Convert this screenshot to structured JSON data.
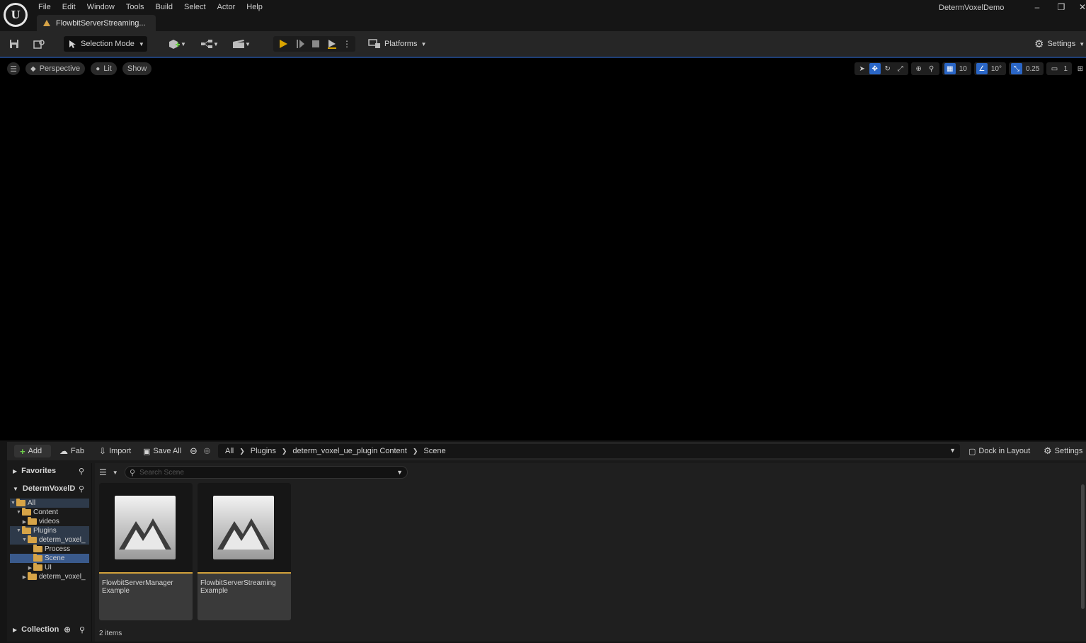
{
  "app": {
    "logo_letter": "U",
    "menu": [
      "File",
      "Edit",
      "Window",
      "Tools",
      "Build",
      "Select",
      "Actor",
      "Help"
    ],
    "document_tab": "FlowbitServerStreaming...",
    "project_name": "DetermVoxelDemo"
  },
  "toolbar": {
    "selection_mode": "Selection Mode",
    "platforms": "Platforms",
    "settings": "Settings"
  },
  "viewport": {
    "perspective": "Perspective",
    "lit": "Lit",
    "show": "Show",
    "grid_snap": "10",
    "rotation_snap": "10°",
    "scale_snap": "0.25",
    "camera_speed": "1"
  },
  "content_browser": {
    "add": "Add",
    "fab": "Fab",
    "import": "Import",
    "save_all": "Save All",
    "path": [
      "All",
      "Plugins",
      "determ_voxel_ue_plugin Content",
      "Scene"
    ],
    "dock_in_layout": "Dock in Layout",
    "settings": "Settings",
    "favorites": "Favorites",
    "project_root": "DetermVoxelD",
    "tree": [
      {
        "label": "All",
        "depth": 0,
        "arrow": "▼"
      },
      {
        "label": "Content",
        "depth": 1,
        "arrow": "▼"
      },
      {
        "label": "videos",
        "depth": 2,
        "arrow": "▶"
      },
      {
        "label": "Plugins",
        "depth": 1,
        "arrow": "▼"
      },
      {
        "label": "determ_voxel_",
        "depth": 2,
        "arrow": "▼"
      },
      {
        "label": "Process",
        "depth": 3,
        "arrow": ""
      },
      {
        "label": "Scene",
        "depth": 3,
        "arrow": ""
      },
      {
        "label": "UI",
        "depth": 3,
        "arrow": "▶"
      },
      {
        "label": "determ_voxel_",
        "depth": 2,
        "arrow": "▶"
      }
    ],
    "collection": "Collection",
    "search_placeholder": "Search Scene",
    "assets": [
      {
        "line1": "FlowbitServerManager",
        "line2": "Example"
      },
      {
        "line1": "FlowbitServerStreaming",
        "line2": "Example"
      }
    ],
    "item_count": "2 items"
  },
  "colors": {
    "accent_blue": "#2a66c6",
    "play_green": "#d9a400",
    "folder": "#d7a447",
    "asset_underline": "#d2a13b"
  }
}
